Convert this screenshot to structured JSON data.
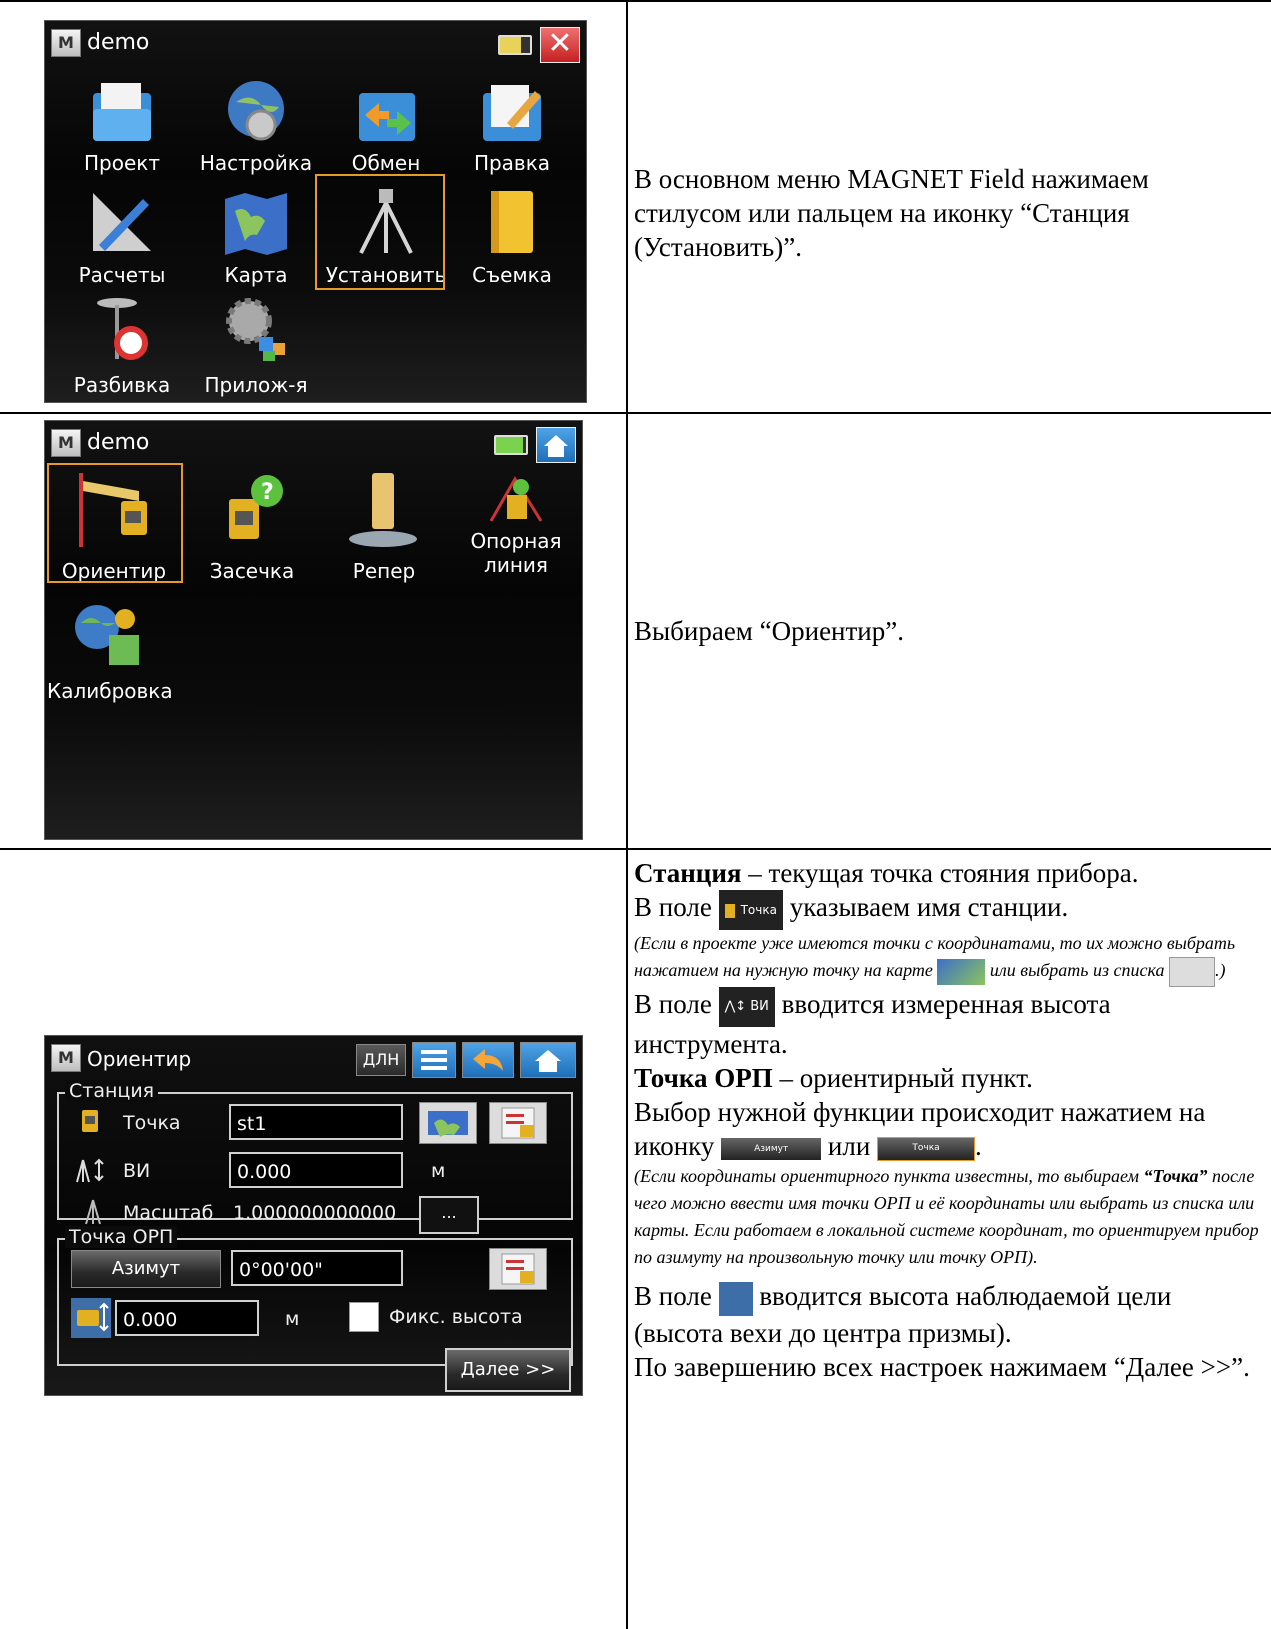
{
  "row1": {
    "screen": {
      "title": "demo",
      "tiles": [
        {
          "label": "Проект",
          "icon": "project-folder-icon"
        },
        {
          "label": "Настройка",
          "icon": "globe-gear-icon"
        },
        {
          "label": "Обмен",
          "icon": "exchange-folder-icon"
        },
        {
          "label": "Правка",
          "icon": "edit-folder-icon"
        },
        {
          "label": "Расчеты",
          "icon": "pencil-ruler-icon"
        },
        {
          "label": "Карта",
          "icon": "map-icon"
        },
        {
          "label": "Установить",
          "icon": "tripod-icon"
        },
        {
          "label": "Съемка",
          "icon": "book-icon"
        },
        {
          "label": "Разбивка",
          "icon": "stake-icon"
        },
        {
          "label": "Прилож-я",
          "icon": "gears-apps-icon"
        }
      ],
      "selected_index": 6
    },
    "description": "В основном меню MAGNET Field нажимаем стилусом или пальцем на иконку “Станция (Установить)”."
  },
  "row2": {
    "screen": {
      "title": "demo",
      "tiles": [
        {
          "label": "Ориентир",
          "icon": "backsight-icon"
        },
        {
          "label": "Засечка",
          "icon": "resection-icon"
        },
        {
          "label": "Репер",
          "icon": "benchmark-icon"
        },
        {
          "label": "Опорная\nлиния",
          "icon": "reference-line-icon"
        },
        {
          "label": "Калибровка",
          "icon": "calibration-icon"
        }
      ],
      "selected_index": 0
    },
    "description": "Выбираем “Ориентир”."
  },
  "row3": {
    "screen": {
      "title": "Ориентир",
      "dln_label": "ДЛН",
      "station_group": "Станция",
      "point_label": "Точка",
      "point_value": "st1",
      "hi_label": "ВИ",
      "hi_value": "0.000",
      "hi_unit": "м",
      "scale_label": "Масштаб",
      "scale_value": "1.000000000000",
      "scale_button": "...",
      "bs_group": "Точка ОРП",
      "azimuth_button": "Азимут",
      "azimuth_value": "0°00'00\"",
      "target_height_value": "0.000",
      "target_height_unit": "м",
      "fixed_height_label": "Фикс. высота",
      "next_button": "Далее >>"
    },
    "desc": {
      "p1_bold": "Станция",
      "p1_rest": " – текущая точка стояния прибора.",
      "p2_a": "В поле ",
      "p2_icon_text": "Точка",
      "p2_b": " указываем имя станции.",
      "n1_a": "(Если в проекте уже имеются точки с координатами, то их можно выбрать нажатием на нужную точку на карте ",
      "n1_b": " или выбрать из списка ",
      "n1_c": ".)",
      "p3_a": "В поле ",
      "p3_icon_text": "ВИ",
      "p3_b": " вводится измеренная высота инструмента.",
      "p4_bold": "Точка ОРП",
      "p4_rest": " – ориентирный пункт.",
      "p5_a": "Выбор нужной функции происходит нажатием на иконку ",
      "p5_btn1": "Азимут",
      "p5_or": " или ",
      "p5_btn2": "Точка",
      "p5_end": ".",
      "n2_a": "(Если координаты ориентирного пункта известны, то выбираем ",
      "n2_bold": "“Точка”",
      "n2_b": " после чего можно ввести имя точки ОРП и её координаты или выбрать из списка или карты. Если работаем в локальной системе координат, то ориентируем прибор по азимуту на произвольную точку или точку ОРП).",
      "p6_a": "В поле ",
      "p6_b": " вводится высота наблюдаемой цели (высота вехи до центра призмы).",
      "p7": "По завершению всех настроек нажимаем “Далее >>”."
    }
  }
}
